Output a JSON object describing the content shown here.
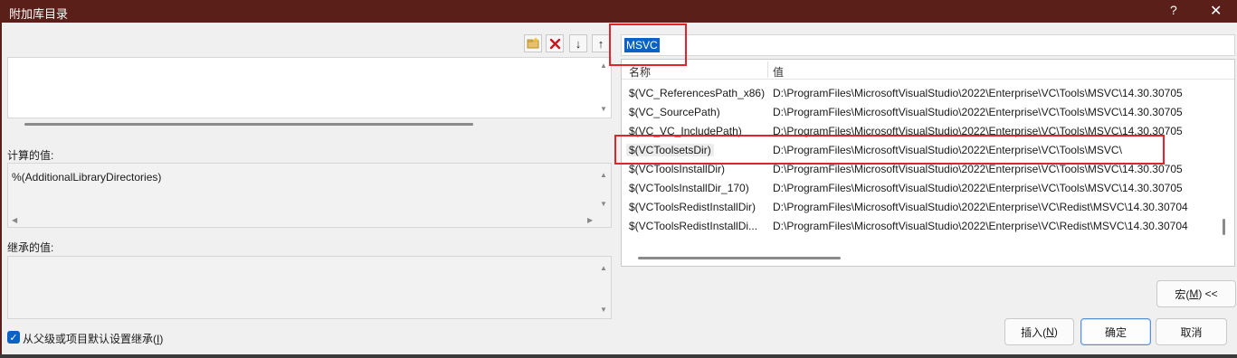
{
  "window": {
    "title": "附加库目录",
    "help": "?",
    "close": "✕"
  },
  "toolbar": {
    "new_line": "new-folder-icon",
    "delete": "delete-icon",
    "move_down": "↓",
    "move_up": "↑"
  },
  "editor": {
    "text": ""
  },
  "evaluated": {
    "label": "计算的值:",
    "value": "%(AdditionalLibraryDirectories)"
  },
  "inherited": {
    "label": "继承的值:",
    "value": ""
  },
  "inherit_checkbox": {
    "checked": true,
    "label_prefix": "从父级或项目默认设置继承(",
    "mnemonic": "I",
    "label_suffix": ")"
  },
  "search": {
    "value": "MSVC"
  },
  "macros": {
    "columns": {
      "name": "名称",
      "value": "值"
    },
    "rows": [
      {
        "name": "$(VC_ReferencesPath_x86)",
        "value": "D:\\ProgramFiles\\MicrosoftVisualStudio\\2022\\Enterprise\\VC\\Tools\\MSVC\\14.30.30705"
      },
      {
        "name": "$(VC_SourcePath)",
        "value": "D:\\ProgramFiles\\MicrosoftVisualStudio\\2022\\Enterprise\\VC\\Tools\\MSVC\\14.30.30705"
      },
      {
        "name": "$(VC_VC_IncludePath)",
        "value": "D:\\ProgramFiles\\MicrosoftVisualStudio\\2022\\Enterprise\\VC\\Tools\\MSVC\\14.30.30705"
      },
      {
        "name": "$(VCToolsetsDir)",
        "value": "D:\\ProgramFiles\\MicrosoftVisualStudio\\2022\\Enterprise\\VC\\Tools\\MSVC\\"
      },
      {
        "name": "$(VCToolsInstallDir)",
        "value": "D:\\ProgramFiles\\MicrosoftVisualStudio\\2022\\Enterprise\\VC\\Tools\\MSVC\\14.30.30705"
      },
      {
        "name": "$(VCToolsInstallDir_170)",
        "value": "D:\\ProgramFiles\\MicrosoftVisualStudio\\2022\\Enterprise\\VC\\Tools\\MSVC\\14.30.30705"
      },
      {
        "name": "$(VCToolsRedistInstallDir)",
        "value": "D:\\ProgramFiles\\MicrosoftVisualStudio\\2022\\Enterprise\\VC\\Redist\\MSVC\\14.30.30704"
      },
      {
        "name": "$(VCToolsRedistInstallDi...",
        "value": "D:\\ProgramFiles\\MicrosoftVisualStudio\\2022\\Enterprise\\VC\\Redist\\MSVC\\14.30.30704"
      }
    ]
  },
  "buttons": {
    "macros": {
      "prefix": "宏(",
      "mnemonic": "M",
      "suffix": ")",
      "arrows": "<<"
    },
    "insert": {
      "prefix": "插入(",
      "mnemonic": "N",
      "suffix": ")"
    },
    "ok": "确定",
    "cancel": "取消"
  },
  "colors": {
    "titlebar": "#5b1f1a",
    "highlight_box": "#e2232a",
    "selection": "#0a62c4"
  }
}
